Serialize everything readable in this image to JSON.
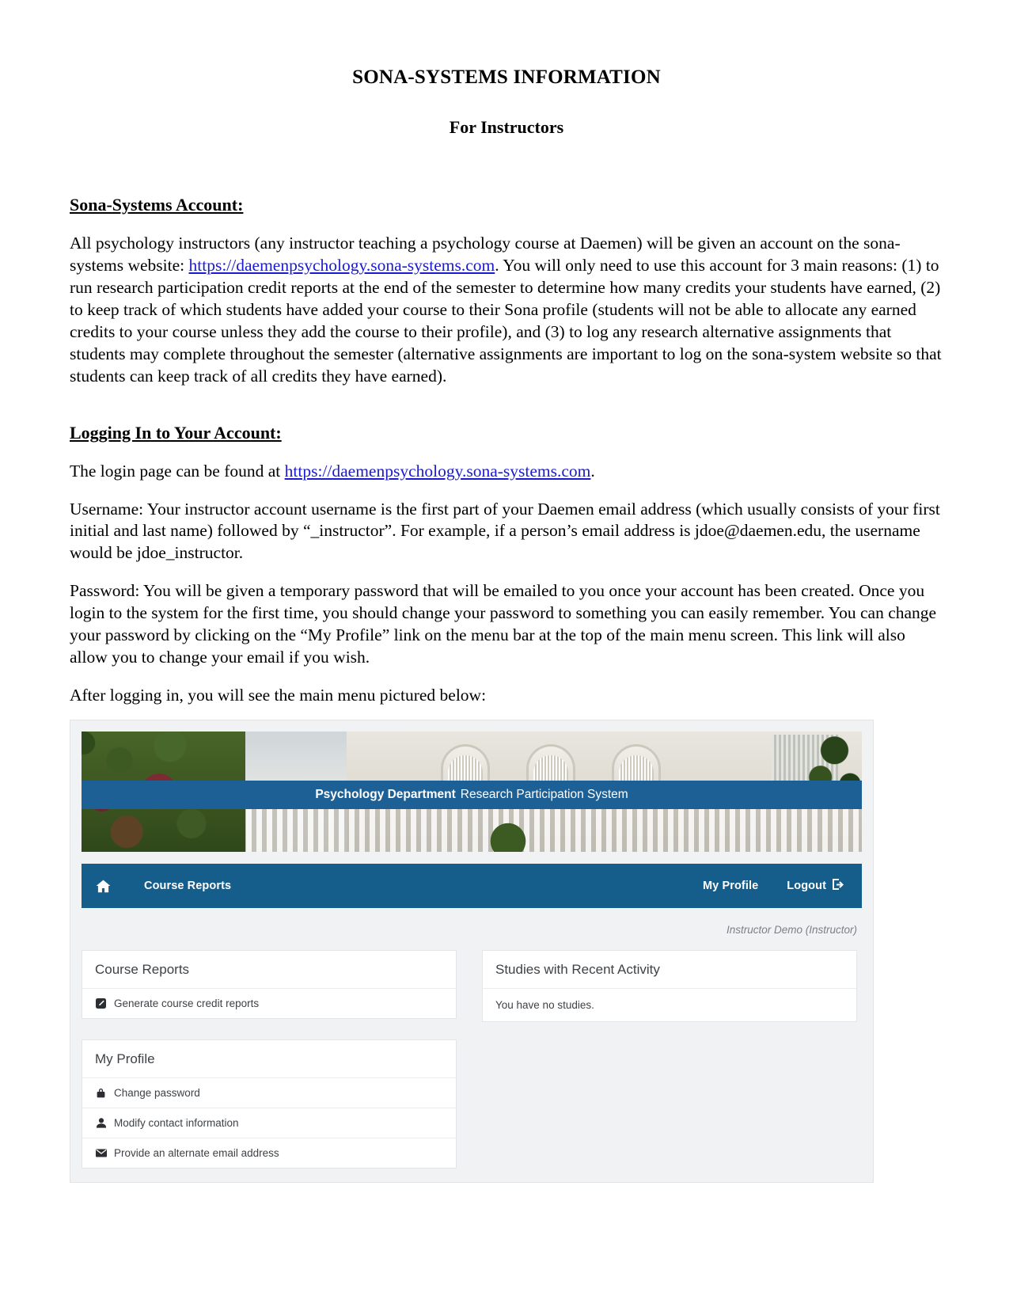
{
  "document": {
    "title": "SONA-SYSTEMS INFORMATION",
    "subtitle": "For Instructors",
    "sections": {
      "account_heading": "Sona-Systems Account:",
      "account_p1_before": "All psychology instructors (any instructor teaching a psychology course at Daemen) will be given an account on the sona-systems website: ",
      "account_link": "https://daemenpsychology.sona-systems.com",
      "account_p1_after": ". You will only need to use this account for 3 main reasons: (1) to run research participation credit reports at the end of the semester to determine how many credits your students have earned, (2) to keep track of which students have added your course to their Sona profile (students will not be able to allocate any earned credits to your course unless they add the course to their profile), and (3) to log any research alternative assignments that students may complete throughout the semester (alternative assignments are important to log on the sona-system website so that students can keep track of all credits they have earned).",
      "login_heading": "Logging In to Your Account:",
      "login_p_before": "The login page can be found at ",
      "login_link": "https://daemenpsychology.sona-systems.com",
      "login_p_after": ".",
      "username_p": "Username: Your instructor account username is the first part of your Daemen email address (which usually consists of your first initial and last name) followed by “_instructor”. For example, if a person’s email address is jdoe@daemen.edu, the username would be jdoe_instructor.",
      "password_p": "Password: You will be given a temporary password that will be emailed to you once your account has been created. Once you login to the system for the first time, you should change your password to something you can easily remember. You can change your password by clicking on the “My Profile” link on the menu bar at the top of the main menu screen. This link will also allow you to change your email if you wish.",
      "caption_p": "After logging in, you will see the main menu pictured below:"
    },
    "link_color": "#1a1ad1"
  },
  "screenshot": {
    "banner": {
      "title_bold": "Psychology Department",
      "title_rest": "Research Participation System",
      "strip_color": "#1d6096"
    },
    "navbar": {
      "home_icon": "home-icon",
      "course_reports": "Course Reports",
      "my_profile": "My Profile",
      "logout": "Logout",
      "logout_icon": "sign-out-icon",
      "background_color": "#155e8c"
    },
    "username_line": "Instructor Demo (Instructor)",
    "panels": [
      {
        "name": "course-reports",
        "heading": "Course Reports",
        "rows": [
          {
            "icon": "edit-square-icon",
            "label": "Generate course credit reports"
          }
        ]
      },
      {
        "name": "my-profile",
        "heading": "My Profile",
        "rows": [
          {
            "icon": "lock-icon",
            "label": "Change password"
          },
          {
            "icon": "user-icon",
            "label": "Modify contact information"
          },
          {
            "icon": "envelope-icon",
            "label": "Provide an alternate email address"
          }
        ]
      },
      {
        "name": "studies-recent-activity",
        "heading": "Studies with Recent Activity",
        "empty_text": "You have no studies."
      }
    ]
  }
}
